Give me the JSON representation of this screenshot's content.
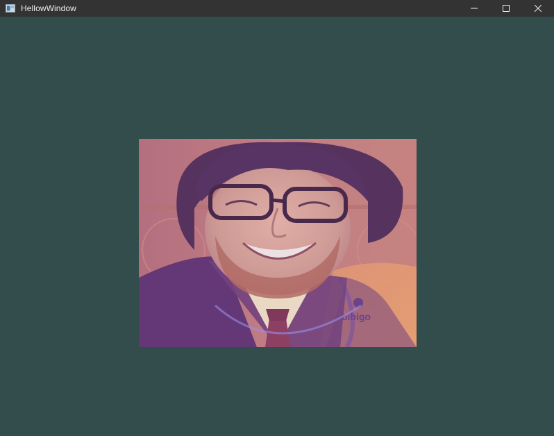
{
  "window": {
    "title": "HellowWindow",
    "background_color": "#334d4d",
    "titlebar_color": "#333333"
  },
  "controls": {
    "minimize_icon": "minimize-icon",
    "maximize_icon": "maximize-icon",
    "close_icon": "close-icon"
  },
  "texture": {
    "description_icon": "blended-photo-texture",
    "overlay_text": "bibigo"
  }
}
